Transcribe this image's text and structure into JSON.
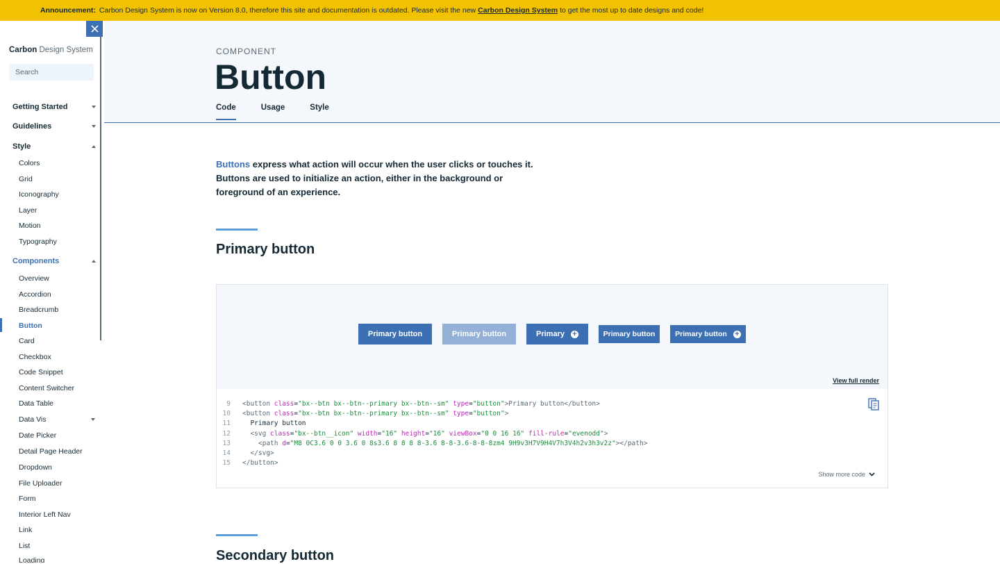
{
  "banner": {
    "label": "Announcement:",
    "text_before": "Carbon Design System is now on Version 8.0, therefore this site and documentation is outdated. Please visit the new",
    "link": "Carbon Design System",
    "text_after": "to get the most up to date designs and code!"
  },
  "sidebar": {
    "brand_bold": "Carbon",
    "brand_light": "Design System",
    "search_placeholder": "Search",
    "sections": [
      {
        "label": "Getting Started",
        "state": "collapsed"
      },
      {
        "label": "Guidelines",
        "state": "collapsed"
      },
      {
        "label": "Style",
        "state": "expanded"
      },
      {
        "label": "Components",
        "state": "expanded"
      }
    ],
    "style_items": [
      "Colors",
      "Grid",
      "Iconography",
      "Layer",
      "Motion",
      "Typography"
    ],
    "component_items": [
      "Overview",
      "Accordion",
      "Breadcrumb",
      "Button",
      "Card",
      "Checkbox",
      "Code Snippet",
      "Content Switcher",
      "Data Table",
      "Data Vis",
      "Date Picker",
      "Detail Page Header",
      "Dropdown",
      "File Uploader",
      "Form",
      "Interior Left Nav",
      "Link",
      "List",
      "Loading"
    ],
    "current_item": "Button"
  },
  "header": {
    "eyebrow": "COMPONENT",
    "title": "Button",
    "tabs": [
      "Code",
      "Usage",
      "Style"
    ],
    "active_tab": "Code"
  },
  "intro": {
    "link": "Buttons",
    "text": "express what action will occur when the user clicks or touches it. Buttons are used to initialize an action, either in the background or foreground of an experience."
  },
  "sections": [
    "Primary button",
    "Secondary button"
  ],
  "demo": {
    "buttons": [
      "Primary button",
      "Primary button",
      "Primary",
      "Primary button",
      "Primary button"
    ],
    "view_full_render": "View full render",
    "show_more_code": "Show more code"
  },
  "code_lines": [
    {
      "n": "9"
    },
    {
      "n": "10"
    },
    {
      "n": "11",
      "text": "  Primary button"
    },
    {
      "n": "12"
    },
    {
      "n": "13"
    },
    {
      "n": "14",
      "text": "  </svg>"
    },
    {
      "n": "15",
      "text": "</button>"
    }
  ],
  "code_tokens": {
    "l9": [
      "<button ",
      "class",
      "=",
      "\"bx--btn bx--btn--primary bx--btn--sm\"",
      " ",
      "type",
      "=",
      "\"button\"",
      ">Primary button</button>"
    ],
    "l10": [
      "<button ",
      "class",
      "=",
      "\"bx--btn bx--btn--primary bx--btn--sm\"",
      " ",
      "type",
      "=",
      "\"button\"",
      ">"
    ],
    "l12": [
      "  <svg ",
      "class",
      "=",
      "\"bx--btn__icon\"",
      " ",
      "width",
      "=",
      "\"16\"",
      " ",
      "height",
      "=",
      "\"16\"",
      " ",
      "viewBox",
      "=",
      "\"0 0 16 16\"",
      " ",
      "fill-rule",
      "=",
      "\"evenodd\"",
      ">"
    ],
    "l13": [
      "    <path ",
      "d",
      "=",
      "\"M8 0C3.6 0 0 3.6 0 8s3.6 8 8 8 8-3.6 8-8-3.6-8-8-8zm4 9H9v3H7V9H4V7h3V4h2v3h3v2z\"",
      "></path>"
    ]
  },
  "colors": {
    "banner": "#f2c100",
    "accent": "#3d70b2",
    "disabled": "#94b0d6"
  }
}
